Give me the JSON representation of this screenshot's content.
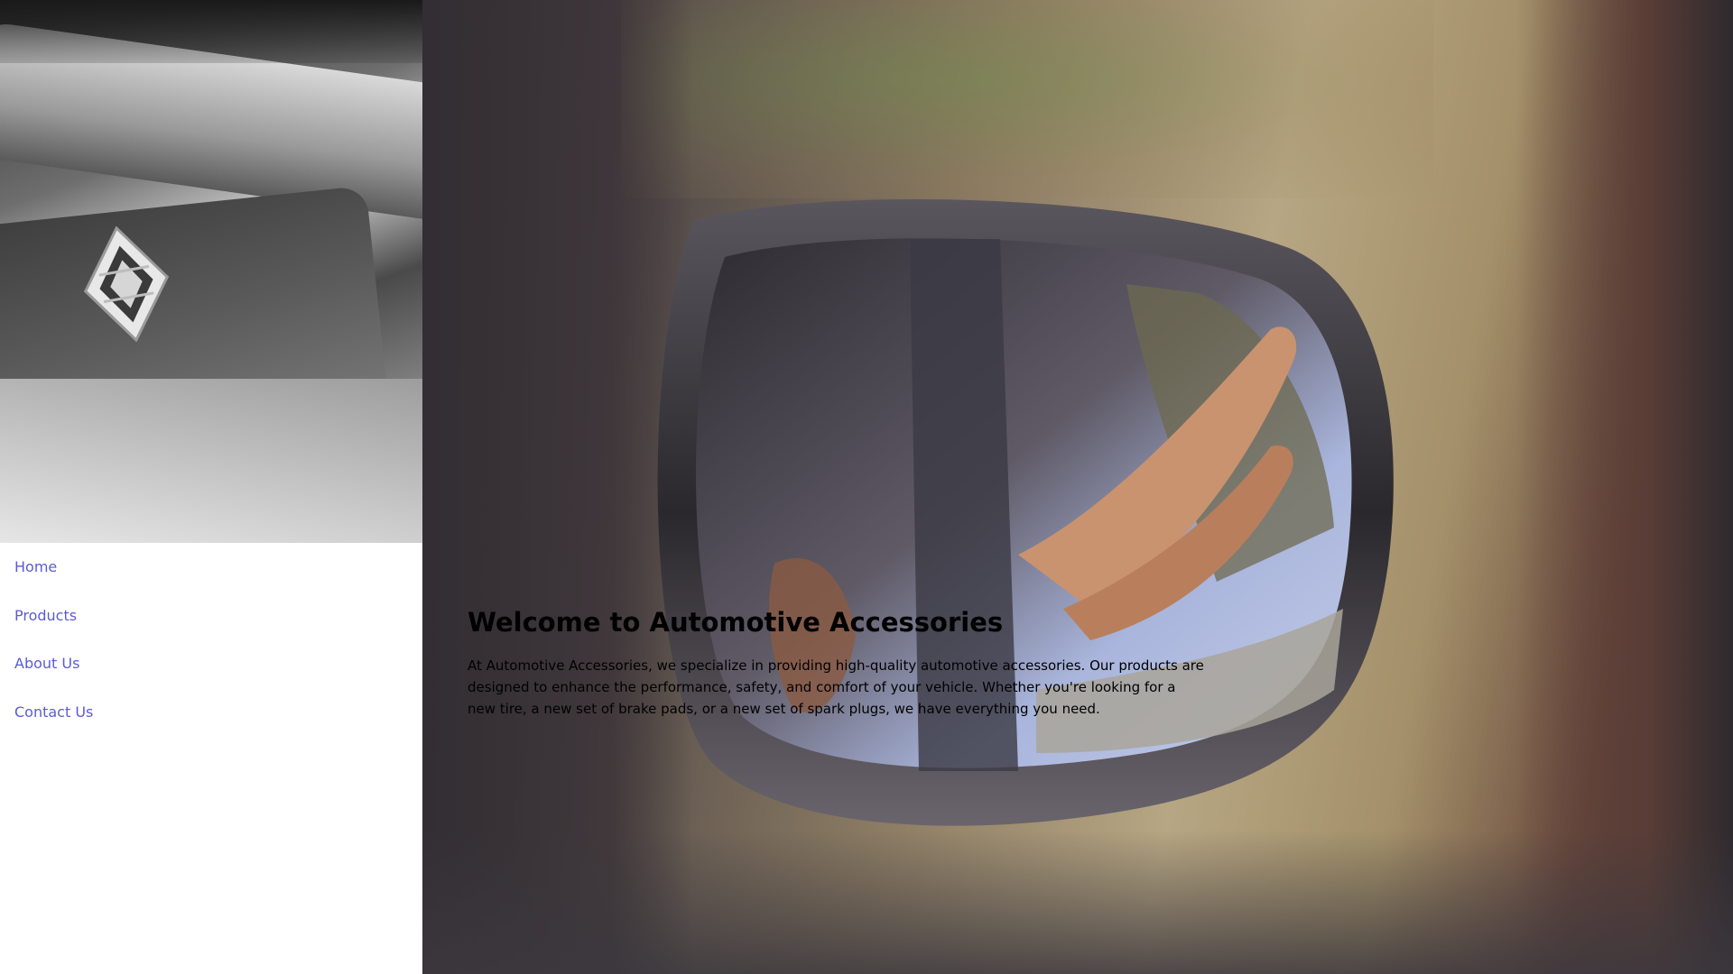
{
  "nav": {
    "items": [
      {
        "label": "Home"
      },
      {
        "label": "Products"
      },
      {
        "label": "About Us"
      },
      {
        "label": "Contact Us"
      }
    ]
  },
  "hero": {
    "title": "Welcome to Automotive Accessories",
    "description": "At Automotive Accessories, we specialize in providing high-quality automotive accessories. Our products are designed to enhance the performance, safety, and comfort of your vehicle. Whether you're looking for a new tire, a new set of brake pads, or a new set of spark plugs, we have everything you need."
  },
  "colors": {
    "link": "#5b5bd6",
    "sidebar_background": "#ffffff",
    "text": "#000000"
  }
}
